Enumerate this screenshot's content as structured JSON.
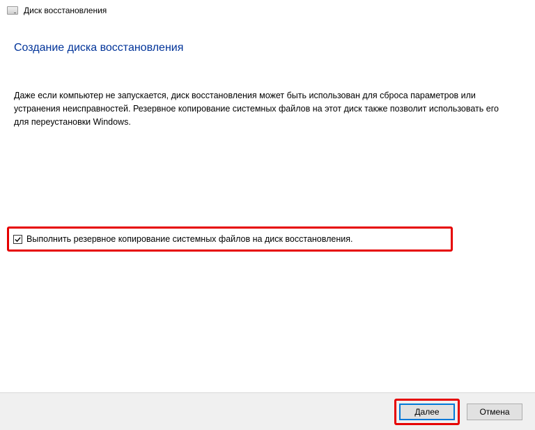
{
  "header": {
    "title": "Диск восстановления"
  },
  "page": {
    "heading": "Создание диска восстановления",
    "description": "Даже если компьютер не запускается, диск восстановления может быть использован для сброса параметров или устранения неисправностей. Резервное копирование системных файлов на этот диск также позволит использовать его для переустановки Windows."
  },
  "checkbox": {
    "checked": true,
    "label": "Выполнить резервное копирование системных файлов на диск восстановления."
  },
  "buttons": {
    "next": "Далее",
    "cancel": "Отмена"
  }
}
